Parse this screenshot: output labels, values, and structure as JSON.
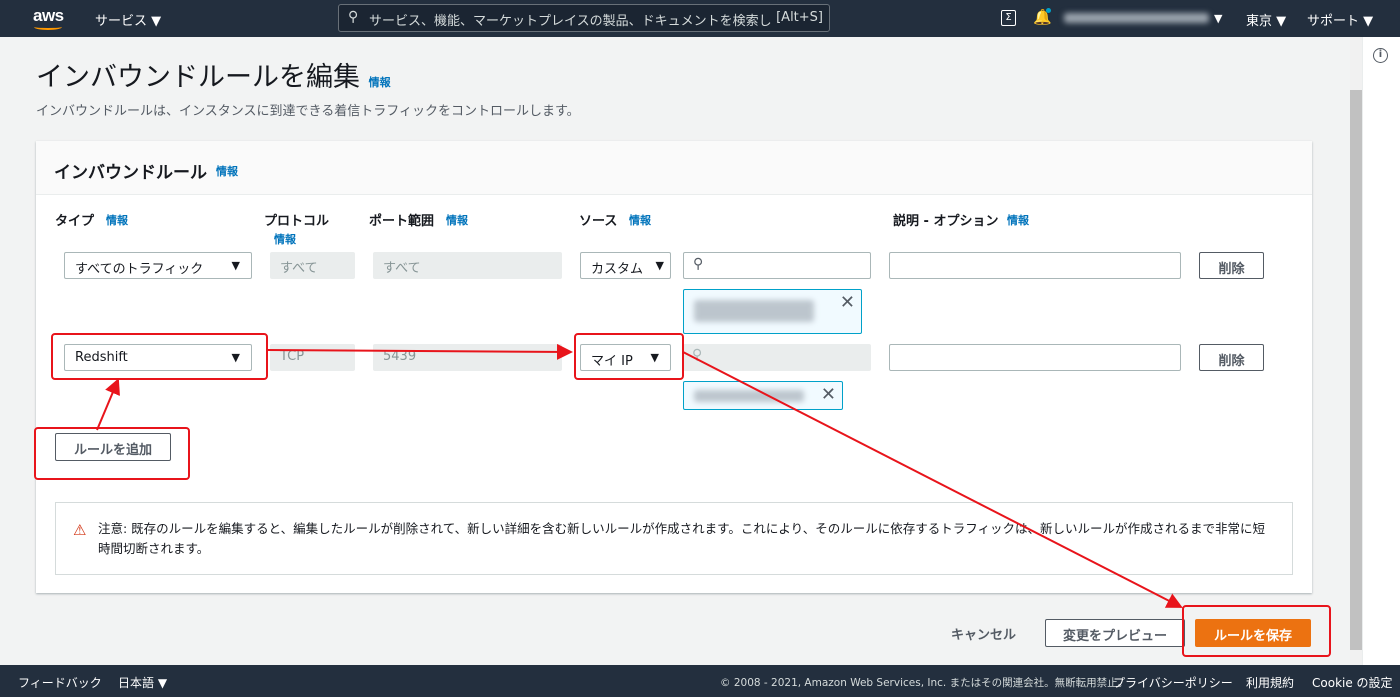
{
  "header": {
    "logo": "aws",
    "services": "サービス ▼",
    "search_placeholder": "サービス、機能、マーケットプレイスの製品、ドキュメントを検索し",
    "search_shortcut": "[Alt+S]",
    "region": "東京 ▼",
    "support": "サポート ▼",
    "account_caret": "▼"
  },
  "page": {
    "title": "インバウンドルールを編集",
    "title_info": "情報",
    "description": "インバウンドルールは、インスタンスに到達できる着信トラフィックをコントロールします。"
  },
  "panel": {
    "title": "インバウンドルール",
    "info": "情報",
    "columns": {
      "type": "タイプ",
      "protocol": "プロトコル",
      "port": "ポート範囲",
      "source": "ソース",
      "description": "説明 - オプション",
      "info": "情報"
    },
    "rules": [
      {
        "type": "すべてのトラフィック",
        "protocol": "すべて",
        "port": "すべて",
        "source": "カスタム",
        "delete": "削除"
      },
      {
        "type": "Redshift",
        "protocol": "TCP",
        "port": "5439",
        "source": "マイ IP",
        "delete": "削除"
      }
    ],
    "add_rule": "ルールを追加",
    "warning": "注意: 既存のルールを編集すると、編集したルールが削除されて、新しい詳細を含む新しいルールが作成されます。これにより、そのルールに依存するトラフィックは、新しいルールが作成されるまで非常に短時間切断されます。"
  },
  "actions": {
    "cancel": "キャンセル",
    "preview": "変更をプレビュー",
    "save": "ルールを保存"
  },
  "footer": {
    "feedback": "フィードバック",
    "language": "日本語 ▼",
    "copyright": "© 2008 - 2021, Amazon Web Services, Inc. またはその関連会社。無断転用禁止。",
    "privacy": "プライバシーポリシー",
    "terms": "利用規約",
    "cookie": "Cookie の設定"
  },
  "colors": {
    "accent": "#ec7211",
    "link": "#0073bb",
    "annotation": "#e8141b"
  }
}
